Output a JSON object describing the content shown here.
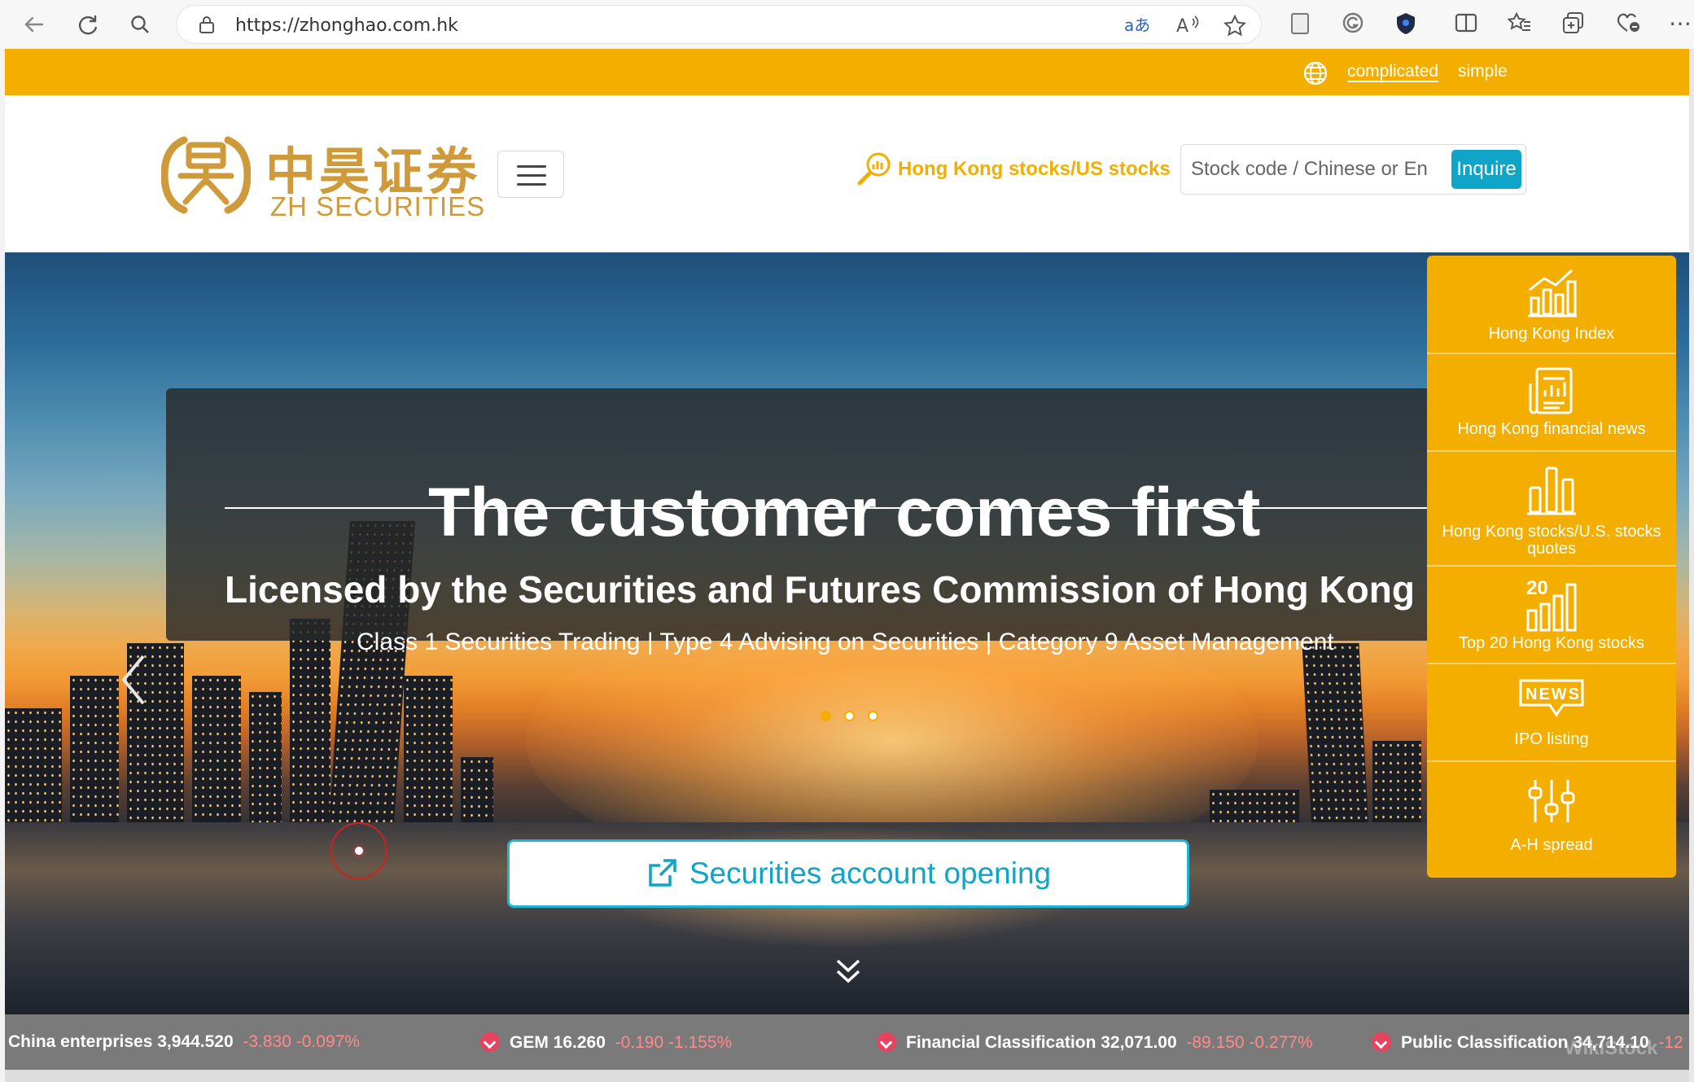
{
  "browser": {
    "url": "https://zhonghao.com.hk"
  },
  "topbar": {
    "lang_complicated": "complicated",
    "lang_simple": "simple"
  },
  "header": {
    "logo_cn": "中昊证券",
    "logo_en": "ZH SECURITIES",
    "quote_label": "Hong Kong stocks/US stocks",
    "search_placeholder": "Stock code / Chinese or En",
    "inquire_label": "Inquire"
  },
  "hero": {
    "title": "The customer comes first",
    "subtitle": "Licensed by the Securities and Futures Commission of Hong Kong",
    "description": "Class 1 Securities Trading | Type 4 Advising on Securities | Category 9 Asset Management",
    "cta": "Securities account opening",
    "carousel_active": 1,
    "carousel_count": 3
  },
  "side_panel": {
    "items": [
      {
        "label": "Hong Kong Index",
        "icon": "rising-chart-icon"
      },
      {
        "label": "Hong Kong financial news",
        "icon": "news-chart-icon"
      },
      {
        "label": "Hong Kong stocks/U.S. stocks quotes",
        "icon": "bar-chart-icon"
      },
      {
        "label": "Top 20 Hong Kong stocks",
        "icon": "top20-chart-icon"
      },
      {
        "label": "IPO listing",
        "icon": "news-badge-icon"
      },
      {
        "label": "A-H spread",
        "icon": "sliders-icon"
      }
    ]
  },
  "ticker": {
    "items": [
      {
        "name": "China enterprises 3,944.520",
        "change": "-3.830 -0.097%"
      },
      {
        "name": "GEM 16.260",
        "change": "-0.190 -1.155%"
      },
      {
        "name": "Financial Classification 32,071.00",
        "change": "-89.150 -0.277%"
      },
      {
        "name": "Public Classification 34,714.10",
        "change": "-12"
      }
    ],
    "watermark": "WikiStock"
  },
  "colors": {
    "brand_orange": "#f4ae00",
    "accent_cyan": "#0ea5c9",
    "logo_gold": "#cf9a3a",
    "down_red": "#e5435f"
  }
}
